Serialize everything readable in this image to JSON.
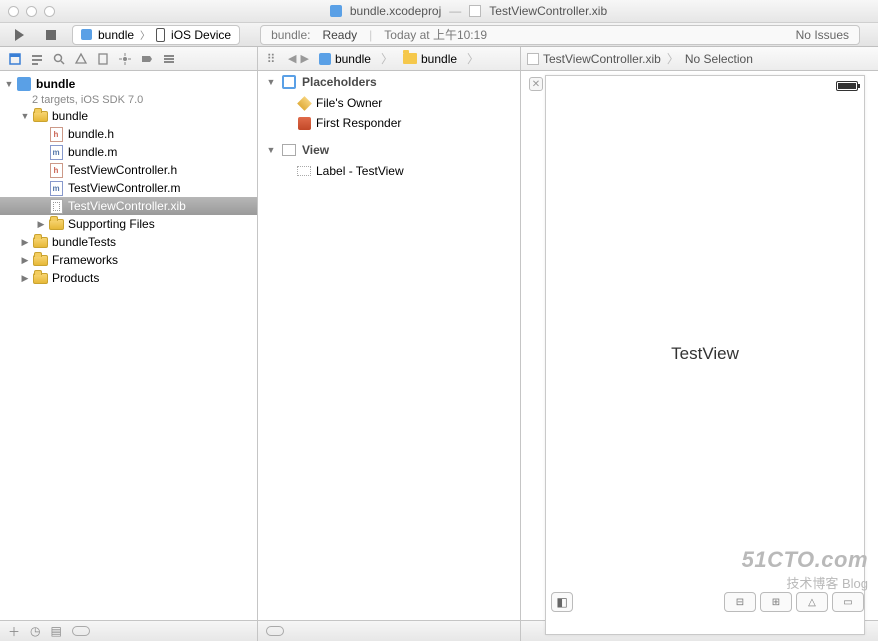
{
  "title": {
    "proj": "bundle.xcodeproj",
    "sep": "—",
    "file": "TestViewController.xib"
  },
  "toolbar": {
    "scheme": "bundle",
    "device": "iOS Device",
    "status_prefix": "bundle:",
    "status_word": "Ready",
    "status_time": "Today at 上午10:19",
    "issues": "No Issues"
  },
  "jumpbar": {
    "items": [
      "bundle",
      "bundle",
      "TestViewController.xib",
      "No Selection"
    ]
  },
  "project": {
    "name": "bundle",
    "subtitle": "2 targets, iOS SDK 7.0",
    "tree": [
      {
        "type": "folder",
        "label": "bundle",
        "open": true,
        "children": [
          {
            "type": "h",
            "label": "bundle.h"
          },
          {
            "type": "m",
            "label": "bundle.m"
          },
          {
            "type": "h",
            "label": "TestViewController.h"
          },
          {
            "type": "m",
            "label": "TestViewController.m"
          },
          {
            "type": "xib",
            "label": "TestViewController.xib",
            "selected": true
          },
          {
            "type": "folder",
            "label": "Supporting Files",
            "open": false,
            "hasChildren": true
          }
        ]
      },
      {
        "type": "folder",
        "label": "bundleTests",
        "open": false,
        "hasChildren": true
      },
      {
        "type": "folder",
        "label": "Frameworks",
        "open": false,
        "hasChildren": true
      },
      {
        "type": "folder",
        "label": "Products",
        "open": false,
        "hasChildren": true
      }
    ]
  },
  "outline": {
    "placeholders_hdr": "Placeholders",
    "placeholders": [
      "File's Owner",
      "First Responder"
    ],
    "view_hdr": "View",
    "view_children": [
      "Label - TestView"
    ]
  },
  "canvas": {
    "label": "TestView"
  },
  "watermark": {
    "l1": "51CTO.com",
    "l2": "技术博客   Blog"
  }
}
